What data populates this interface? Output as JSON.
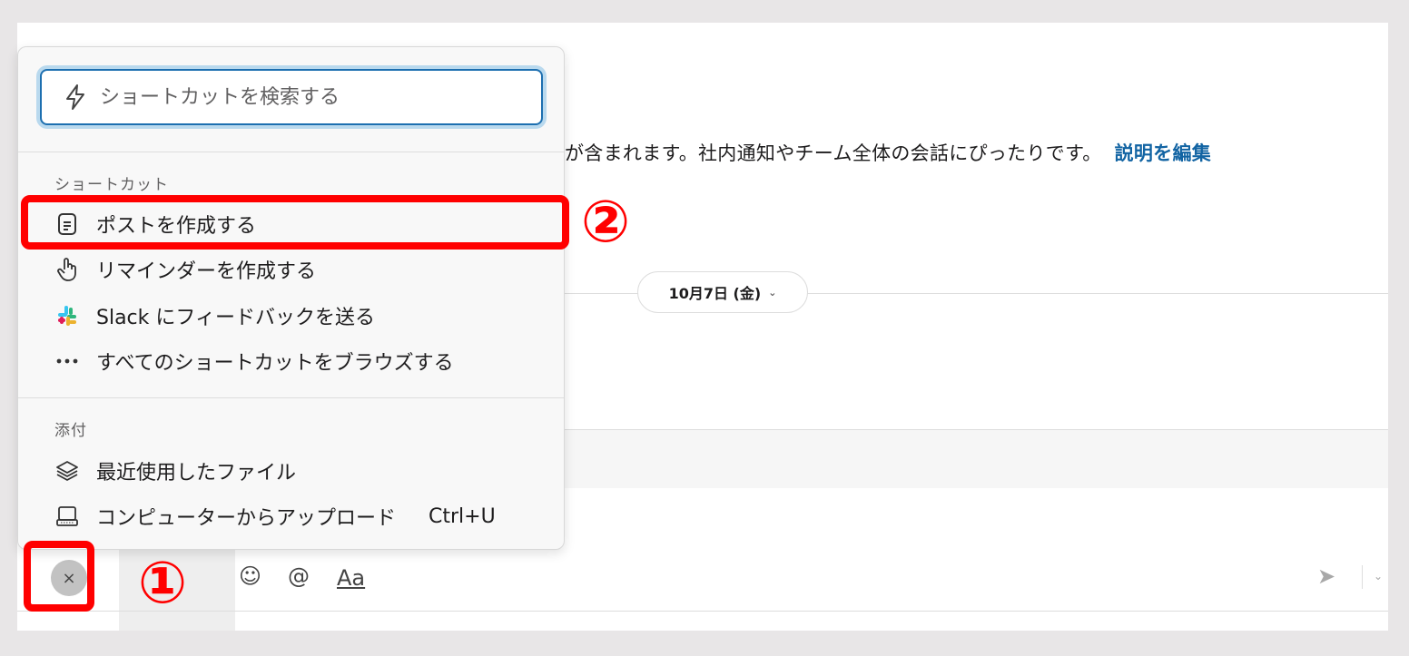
{
  "channel": {
    "description": "が含まれます。社内通知やチーム全体の会話にぴったりです。",
    "edit_link": "説明を編集",
    "date_label": "10月7日 (金)"
  },
  "menu": {
    "search_placeholder": "ショートカットを検索する",
    "shortcuts_section": "ショートカット",
    "items": [
      {
        "label": "ポストを作成する",
        "icon": "document-icon"
      },
      {
        "label": "リマインダーを作成する",
        "icon": "hand-pointer-icon"
      },
      {
        "label": "Slack にフィードバックを送る",
        "icon": "slack-logo-icon"
      },
      {
        "label": "すべてのショートカットをブラウズする",
        "icon": "more-dots-icon"
      }
    ],
    "attachments_section": "添付",
    "attachments": [
      {
        "label": "最近使用したファイル",
        "icon": "layers-icon"
      },
      {
        "label": "コンピューターからアップロード",
        "shortcut": "Ctrl+U",
        "icon": "computer-icon"
      }
    ]
  },
  "composer": {
    "close_glyph": "×",
    "emoji_glyph": "☺",
    "mention_glyph": "@",
    "format_label": "Aa",
    "send_glyph": "➤",
    "chevron_glyph": "⌄"
  },
  "annotations": {
    "marker1": "①",
    "marker2": "②"
  },
  "colors": {
    "accent_red": "#ff0000",
    "link_blue": "#1264a3",
    "focus_blue": "#1d6fb0"
  }
}
